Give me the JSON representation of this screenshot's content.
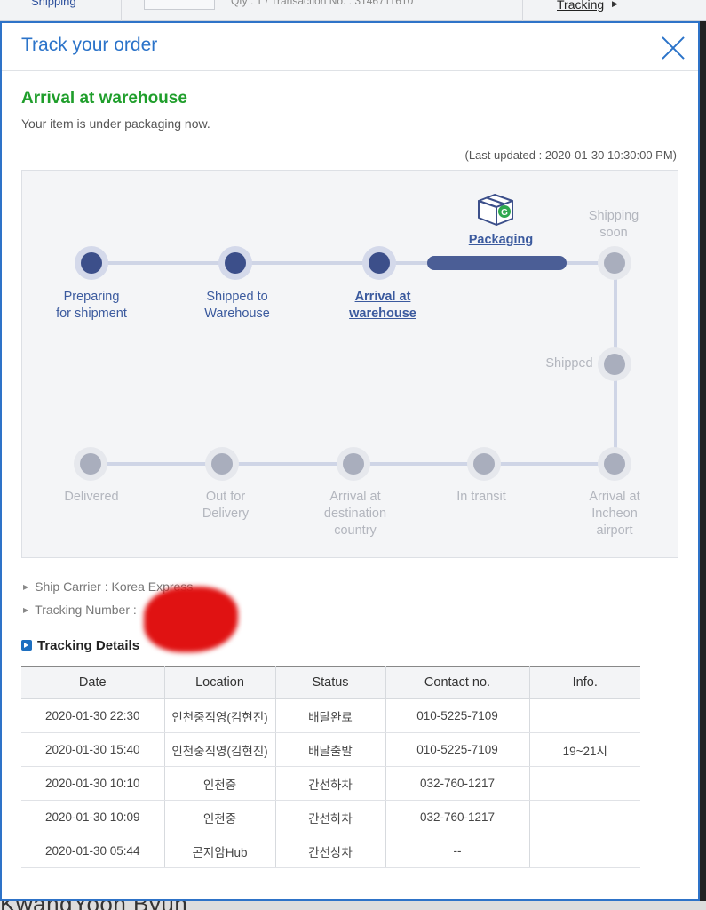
{
  "background": {
    "shipping_label": "Shipping",
    "qty_text": "Qty : 1 / Transaction No. : 3146711610",
    "tracking_link": "Tracking",
    "bottom_text": "KwangYoon Byun"
  },
  "modal": {
    "title": "Track your order",
    "close_icon": "close-icon",
    "status_title": "Arrival at warehouse",
    "status_subtitle": "Your item is under packaging now.",
    "last_updated": "(Last updated : 2020-01-30 10:30:00 PM)",
    "progress": {
      "current_step_icon": "package-box-icon",
      "steps": [
        {
          "label_line1": "Preparing",
          "label_line2": "for shipment",
          "state": "done"
        },
        {
          "label_line1": "Shipped to",
          "label_line2": "Warehouse",
          "state": "done"
        },
        {
          "label_line1": "Arrival at",
          "label_line2": "warehouse",
          "state": "done-current"
        },
        {
          "label_line1": "Packaging",
          "label_line2": "",
          "state": "current"
        },
        {
          "label_line1": "Shipping",
          "label_line2": "soon",
          "state": "pending"
        },
        {
          "label_line1": "Shipped",
          "label_line2": "",
          "state": "pending"
        },
        {
          "label_line1": "Arrival at",
          "label_line2": "Incheon",
          "label_line3": "airport",
          "state": "pending"
        },
        {
          "label_line1": "In transit",
          "label_line2": "",
          "state": "pending"
        },
        {
          "label_line1": "Arrival at",
          "label_line2": "destination",
          "label_line3": "country",
          "state": "pending"
        },
        {
          "label_line1": "Out for",
          "label_line2": "Delivery",
          "state": "pending"
        },
        {
          "label_line1": "Delivered",
          "label_line2": "",
          "state": "pending"
        }
      ]
    },
    "carrier_line": "Ship Carrier : Korea Express",
    "tracking_number_label": "Tracking Number :",
    "tracking_details_title": "Tracking Details",
    "table": {
      "headers": [
        "Date",
        "Location",
        "Status",
        "Contact no.",
        "Info."
      ],
      "rows": [
        [
          "2020-01-30 22:30",
          "인천중직영(김현진)",
          "배달완료",
          "010-5225-7109",
          ""
        ],
        [
          "2020-01-30 15:40",
          "인천중직영(김현진)",
          "배달출발",
          "010-5225-7109",
          "19~21시"
        ],
        [
          "2020-01-30 10:10",
          "인천중",
          "간선하차",
          "032-760-1217",
          ""
        ],
        [
          "2020-01-30 10:09",
          "인천중",
          "간선하차",
          "032-760-1217",
          ""
        ],
        [
          "2020-01-30 05:44",
          "곤지암Hub",
          "간선상차",
          "--",
          ""
        ]
      ]
    }
  }
}
